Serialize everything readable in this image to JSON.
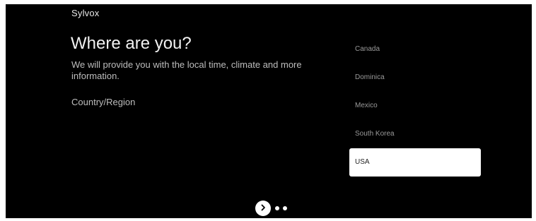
{
  "brand": "Sylvox",
  "title": "Where are you?",
  "description": "We will provide you with the local time, climate and more information.",
  "field_label": "Country/Region",
  "countries": [
    "Canada",
    "Dominica",
    "Mexico",
    "South Korea",
    "USA"
  ],
  "selected_country": "USA",
  "pager": {
    "icon": "chevron-right-icon",
    "dots": 2
  },
  "colors": {
    "background": "#000000",
    "selected_bg": "#ffffff",
    "muted_text": "#9a9a9a"
  }
}
